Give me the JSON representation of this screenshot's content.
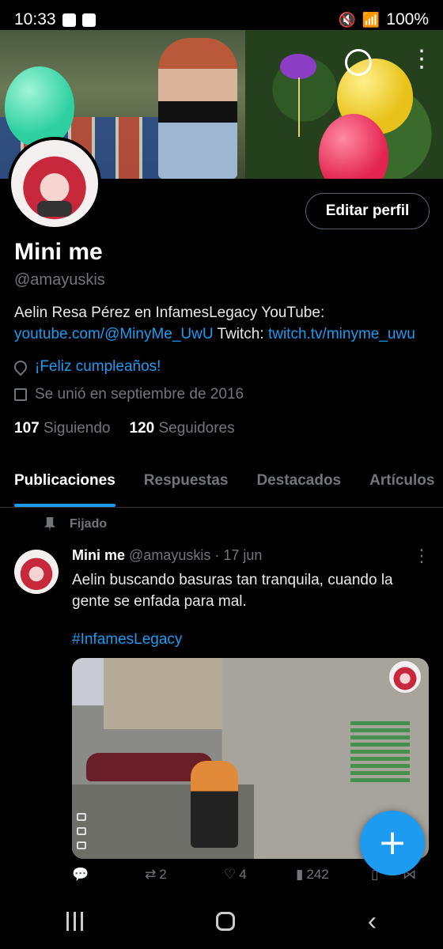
{
  "status_bar": {
    "time": "10:33",
    "battery": "100%"
  },
  "profile": {
    "edit_button": "Editar perfil",
    "display_name": "Mini me",
    "handle": "@amayuskis",
    "bio_text": "Aelin Resa Pérez en InfamesLegacy  YouTube: ",
    "bio_youtube_link": "youtube.com/@MinyMe_UwU",
    "bio_twitch_label": " Twitch: ",
    "bio_twitch_link": "twitch.tv/minyme_uwu",
    "location": "¡Feliz cumpleaños!",
    "joined": "Se unió en septiembre de 2016",
    "following_count": "107",
    "following_label": "Siguiendo",
    "followers_count": "120",
    "followers_label": "Seguidores"
  },
  "tabs": [
    {
      "label": "Publicaciones",
      "active": true
    },
    {
      "label": "Respuestas",
      "active": false
    },
    {
      "label": "Destacados",
      "active": false
    },
    {
      "label": "Artículos",
      "active": false
    }
  ],
  "post": {
    "pinned_label": "Fijado",
    "author_name": "Mini me",
    "author_handle": "@amayuskis",
    "separator": " · ",
    "date": "17 jun",
    "text": "Aelin buscando basuras tan tranquila,  cuando la gente se enfada para mal.",
    "hashtag": "#InfamesLegacy",
    "retweets": "2",
    "likes": "4",
    "views": "242"
  },
  "colors": {
    "accent": "#1d9bf0",
    "background": "#000000",
    "muted": "#71767b"
  }
}
